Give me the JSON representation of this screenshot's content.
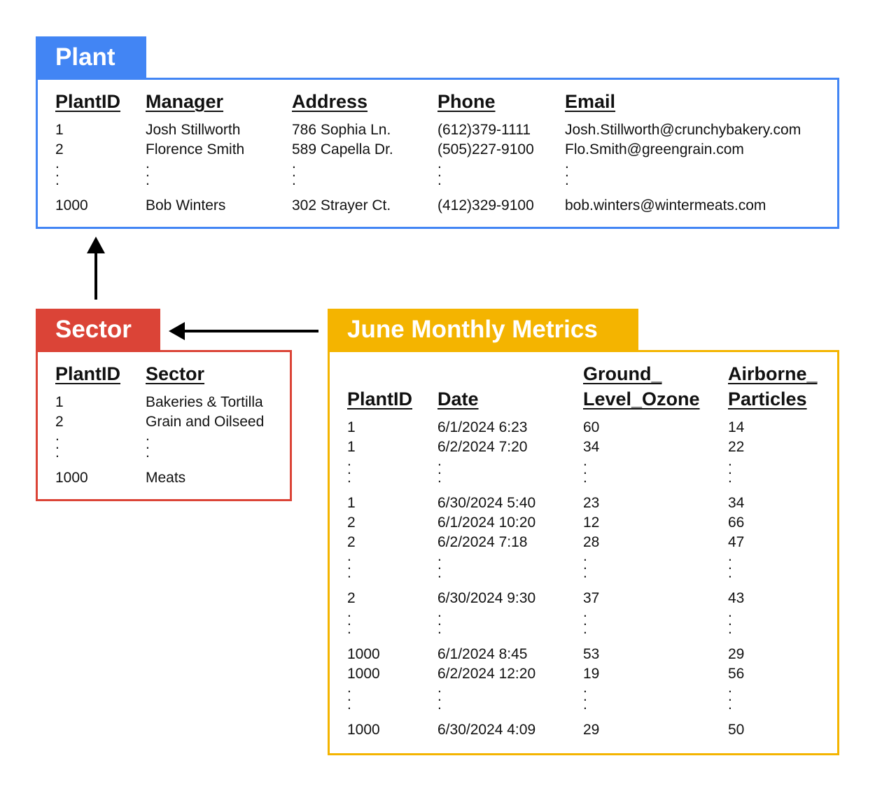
{
  "colors": {
    "plant": "#4285f4",
    "sector": "#db4437",
    "metrics": "#f4b400",
    "arrow": "#000000"
  },
  "plant": {
    "title": "Plant",
    "headers": [
      "PlantID",
      "Manager",
      "Address",
      "Phone",
      "Email"
    ],
    "rows": [
      [
        "1",
        "Josh Stillworth",
        "786 Sophia Ln.",
        "(612)379-1111",
        "Josh.Stillworth@crunchybakery.com"
      ],
      [
        "2",
        "Florence Smith",
        "589 Capella Dr.",
        "(505)227-9100",
        "Flo.Smith@greengrain.com"
      ],
      [
        "1000",
        "Bob Winters",
        "302 Strayer Ct.",
        "(412)329-9100",
        "bob.winters@wintermeats.com"
      ]
    ]
  },
  "sector": {
    "title": "Sector",
    "headers": [
      "PlantID",
      "Sector"
    ],
    "rows": [
      [
        "1",
        "Bakeries & Tortilla"
      ],
      [
        "2",
        "Grain and Oilseed"
      ],
      [
        "1000",
        "Meats"
      ]
    ]
  },
  "metrics": {
    "title": "June Monthly Metrics",
    "headers": [
      "PlantID",
      "Date",
      "Ground_\nLevel_Ozone",
      "Airborne_\nParticles"
    ],
    "rows": [
      [
        "1",
        "6/1/2024 6:23",
        "60",
        "14"
      ],
      [
        "1",
        "6/2/2024 7:20",
        "34",
        "22"
      ],
      [
        "1",
        "6/30/2024 5:40",
        "23",
        "34"
      ],
      [
        "2",
        "6/1/2024 10:20",
        "12",
        "66"
      ],
      [
        "2",
        "6/2/2024 7:18",
        "28",
        "47"
      ],
      [
        "2",
        "6/30/2024 9:30",
        "37",
        "43"
      ],
      [
        "1000",
        "6/1/2024 8:45",
        "53",
        "29"
      ],
      [
        "1000",
        "6/2/2024 12:20",
        "19",
        "56"
      ],
      [
        "1000",
        "6/30/2024 4:09",
        "29",
        "50"
      ]
    ]
  }
}
